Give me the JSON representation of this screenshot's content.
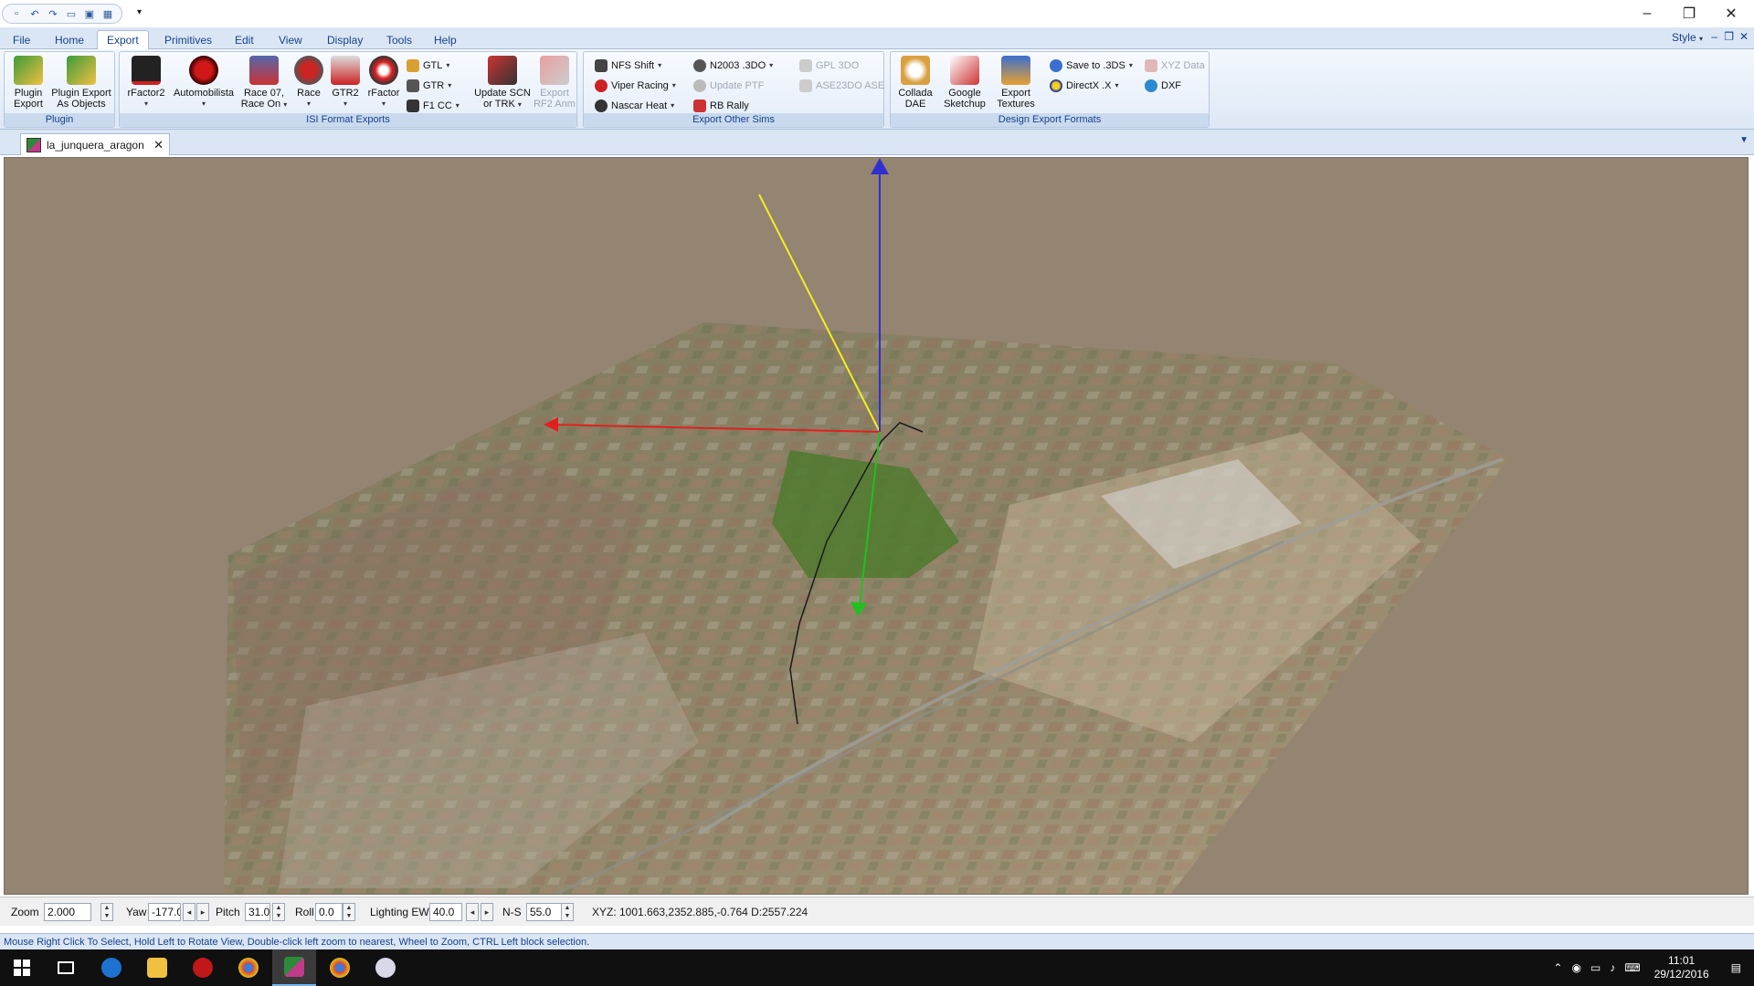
{
  "ribbon_tabs": [
    "File",
    "Home",
    "Export",
    "Primitives",
    "Edit",
    "View",
    "Display",
    "Tools",
    "Help"
  ],
  "active_tab": "Export",
  "style_menu": "Style",
  "groups": {
    "plugin": {
      "label": "Plugin",
      "plugin_export": [
        "Plugin",
        "Export"
      ],
      "plugin_export_objects": [
        "Plugin Export",
        "As Objects"
      ]
    },
    "isi": {
      "label": "ISI Format Exports",
      "rfactor2": "rFactor2",
      "automobilista": "Automobilista",
      "race07": [
        "Race 07,",
        "Race On"
      ],
      "race": "Race",
      "gtr2": "GTR2",
      "rfactor": "rFactor",
      "gtl": "GTL",
      "gtr": "GTR",
      "f1cc": "F1 CC",
      "update_scn": [
        "Update SCN",
        "or TRK"
      ],
      "export_rf2_anm": [
        "Export",
        "RF2 Anm"
      ]
    },
    "other_sims": {
      "label": "Export Other Sims",
      "nfs_shift": "NFS Shift",
      "viper_racing": "Viper Racing",
      "nascar_heat": "Nascar Heat",
      "n2003": "N2003 .3DO",
      "update_ptf": "Update PTF",
      "rb_rally": "RB Rally",
      "gpl_3do": "GPL 3DO",
      "ase23do": "ASE23DO ASE"
    },
    "design": {
      "label": "Design Export Formats",
      "collada": [
        "Collada",
        "DAE"
      ],
      "sketchup": [
        "Google",
        "Sketchup"
      ],
      "export_textures": [
        "Export",
        "Textures"
      ],
      "save_3ds": "Save to .3DS",
      "directx": "DirectX .X",
      "xyz_data": "XYZ Data",
      "dxf": "DXF"
    }
  },
  "document_tab": "la_junquera_aragon",
  "view_controls": {
    "zoom_label": "Zoom",
    "zoom_value": "2.000",
    "yaw_label": "Yaw",
    "yaw_value": "-177.0",
    "pitch_label": "Pitch",
    "pitch_value": "31.0",
    "roll_label": "Roll",
    "roll_value": "0.0",
    "lighting_ew_label": "Lighting EW",
    "lighting_ew_value": "40.0",
    "ns_label": "N-S",
    "ns_value": "55.0",
    "xyz_readout": "XYZ: 1001.663,2352.885,-0.764  D:2557.224"
  },
  "status_text": "Mouse Right Click To Select, Hold Left to Rotate View, Double-click left  zoom to nearest, Wheel to Zoom, CTRL Left block selection.",
  "taskbar": {
    "time": "11:01",
    "date": "29/12/2016"
  },
  "colors": {
    "viewport_bg": "#948472",
    "ribbon_bg": "#dde8f6",
    "accent": "#15428b",
    "axis_x": "#e02020",
    "axis_y": "#20c020",
    "axis_z": "#3030d0",
    "sun_ray": "#f0f020"
  }
}
